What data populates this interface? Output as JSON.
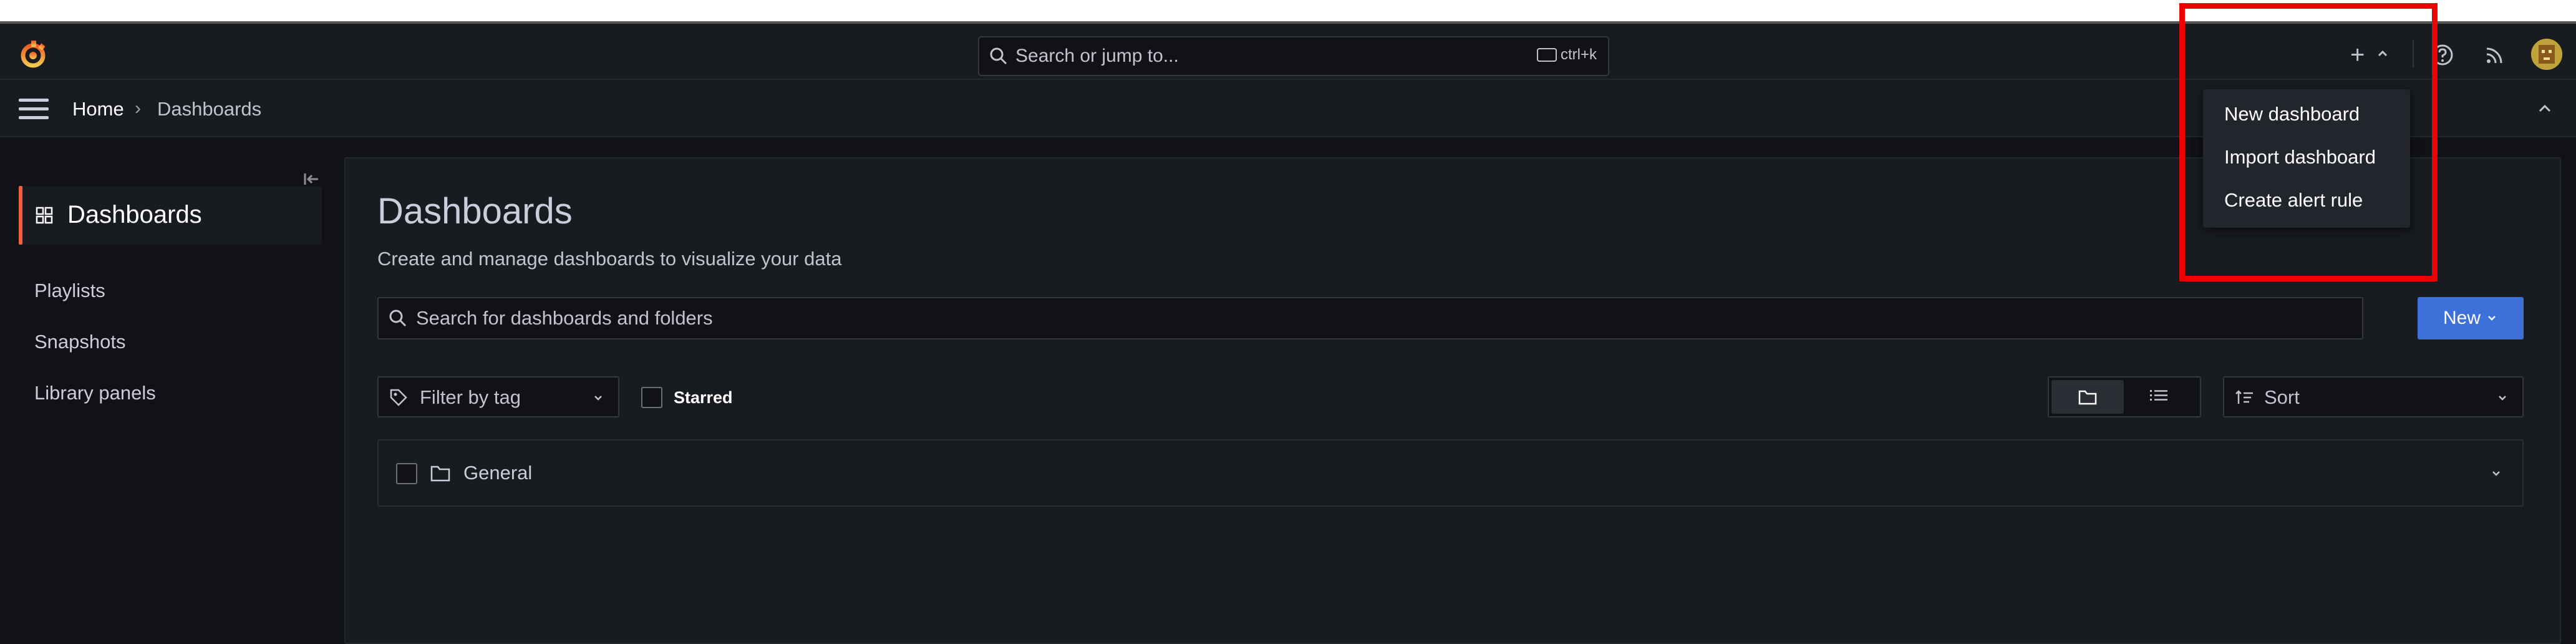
{
  "topbar": {
    "search_placeholder": "Search or jump to...",
    "search_shortcut": "ctrl+k",
    "plus_label": "+"
  },
  "breadcrumb": {
    "home": "Home",
    "separator": "›",
    "current": "Dashboards"
  },
  "sidebar": {
    "active_item": "Dashboards",
    "items": [
      {
        "label": "Playlists"
      },
      {
        "label": "Snapshots"
      },
      {
        "label": "Library panels"
      }
    ]
  },
  "main": {
    "title": "Dashboards",
    "subtitle": "Create and manage dashboards to visualize your data",
    "search_placeholder": "Search for dashboards and folders",
    "new_button": "New",
    "filter_by_tag": "Filter by tag",
    "starred_label": "Starred",
    "sort_label": "Sort",
    "folders": [
      {
        "name": "General"
      }
    ]
  },
  "new_menu": {
    "items": [
      {
        "label": "New dashboard"
      },
      {
        "label": "Import dashboard"
      },
      {
        "label": "Create alert rule"
      }
    ]
  },
  "colors": {
    "accent_orange": "#f55f3e",
    "primary_blue": "#3d71d9",
    "highlight_red": "#ee0000",
    "background": "#111217",
    "panel": "#181b1f"
  },
  "icons": {
    "logo": "grafana-logo-icon",
    "search": "search-icon",
    "keyboard": "keyboard-icon",
    "help": "help-icon",
    "news": "rss-icon",
    "menu": "hamburger-icon",
    "dock": "dock-menu-icon",
    "dashboards": "apps-grid-icon",
    "tag": "tag-icon",
    "folder_view": "folder-icon",
    "list_view": "list-icon",
    "sort": "sort-icon"
  }
}
